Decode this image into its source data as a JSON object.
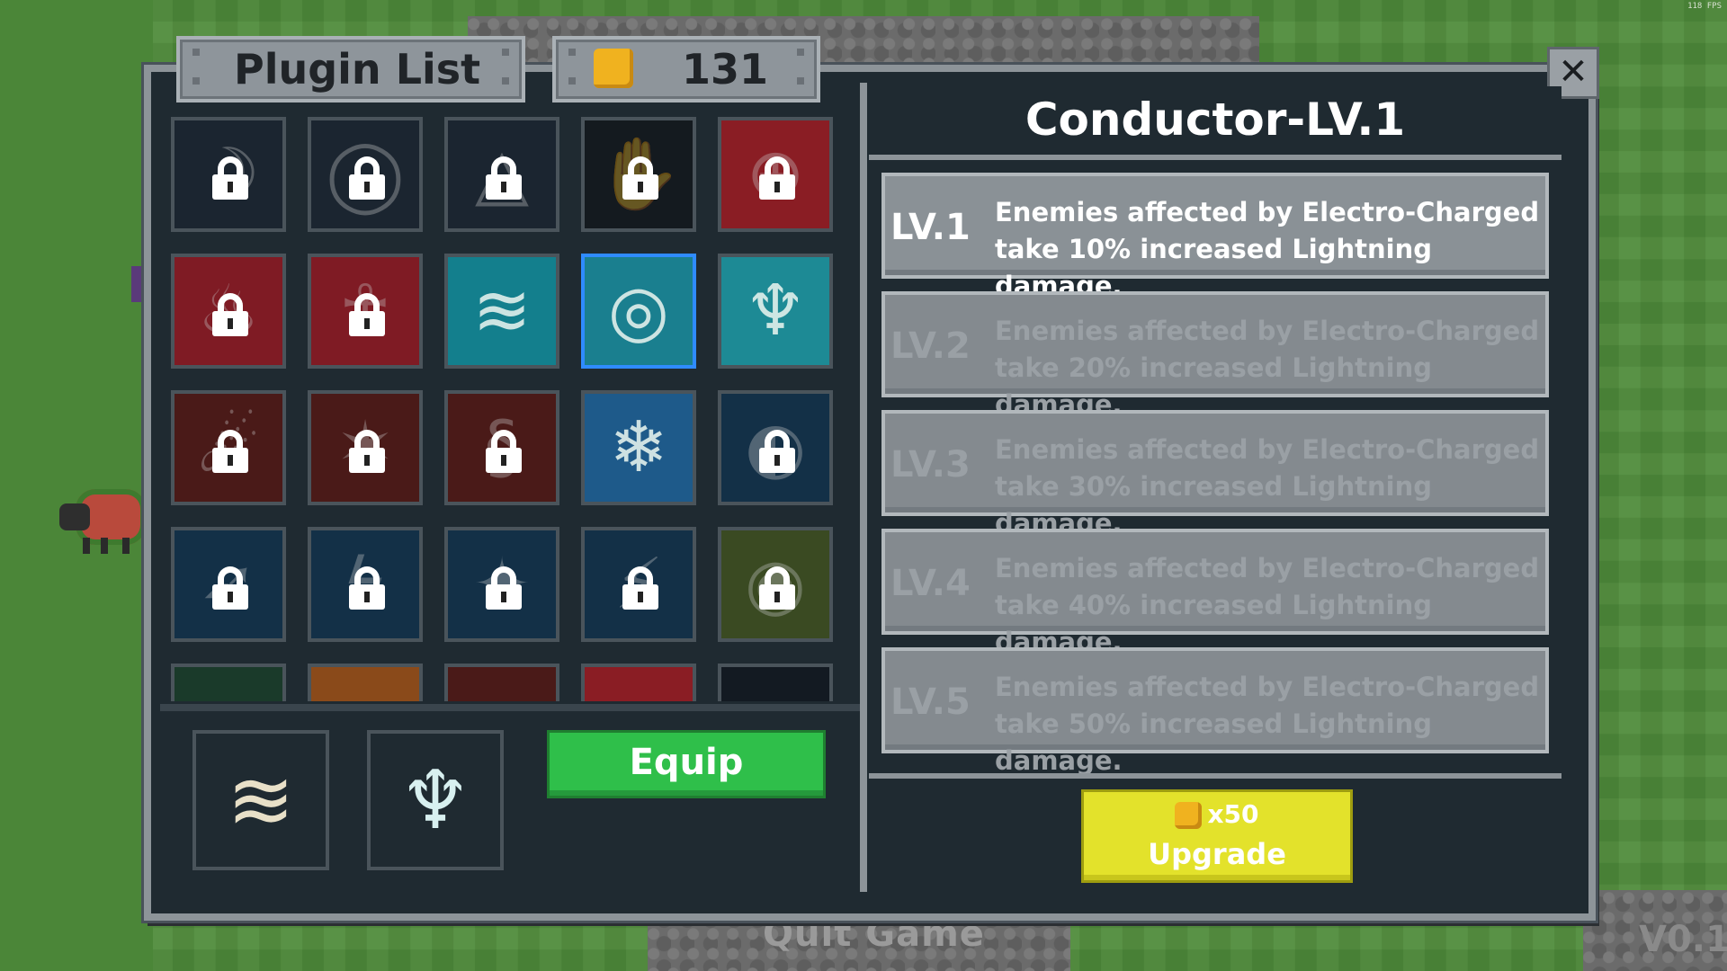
{
  "fps": "118 FPS",
  "footer": {
    "quit": "Quit Game",
    "version": "V0.1"
  },
  "header": {
    "title": "Plugin List",
    "coins": "131"
  },
  "close_label": "✕",
  "grid": [
    {
      "bg": "#1b2530",
      "glyph": "☽",
      "locked": true
    },
    {
      "bg": "#1b2530",
      "glyph": "◯",
      "locked": true
    },
    {
      "bg": "#1b2530",
      "glyph": "△",
      "locked": true
    },
    {
      "bg": "#141a1f",
      "glyph": "✋",
      "locked": true
    },
    {
      "bg": "#8a1d24",
      "glyph": "⊕",
      "locked": true
    },
    {
      "bg": "#7f1b24",
      "glyph": "♨",
      "locked": true
    },
    {
      "bg": "#7f1b24",
      "glyph": "☥",
      "locked": true
    },
    {
      "bg": "#137f8d",
      "glyph": "≋",
      "locked": false
    },
    {
      "bg": "#1a7f8f",
      "glyph": "◎",
      "locked": false,
      "selected": true
    },
    {
      "bg": "#1d8a95",
      "glyph": "♆",
      "locked": false
    },
    {
      "bg": "#4a1a18",
      "glyph": "☄",
      "locked": true
    },
    {
      "bg": "#4a1a18",
      "glyph": "✶",
      "locked": true
    },
    {
      "bg": "#4a1a18",
      "glyph": "§",
      "locked": true
    },
    {
      "bg": "#1e5a8a",
      "glyph": "❄",
      "locked": false
    },
    {
      "bg": "#133047",
      "glyph": "◐",
      "locked": true
    },
    {
      "bg": "#133047",
      "glyph": "➶",
      "locked": true
    },
    {
      "bg": "#133047",
      "glyph": "ϟ",
      "locked": true
    },
    {
      "bg": "#133047",
      "glyph": "✦",
      "locked": true
    },
    {
      "bg": "#133047",
      "glyph": "⚡",
      "locked": true
    },
    {
      "bg": "#3a4a22",
      "glyph": "◉",
      "locked": true
    },
    {
      "bg": "#1a3a2a",
      "glyph": "",
      "locked": false
    },
    {
      "bg": "#8a4a1a",
      "glyph": "",
      "locked": false
    },
    {
      "bg": "#4a1a18",
      "glyph": "",
      "locked": false
    },
    {
      "bg": "#8a1d24",
      "glyph": "",
      "locked": false
    },
    {
      "bg": "#131a22",
      "glyph": "",
      "locked": false
    }
  ],
  "equipped": [
    {
      "bg": "#137f8d",
      "glyph": "≋"
    },
    {
      "bg": "#1d8a95",
      "glyph": "♆"
    }
  ],
  "equip_label": "Equip",
  "detail": {
    "title": "Conductor-LV.1",
    "levels": [
      {
        "tag": "LV.1",
        "desc": "Enemies affected by Electro-Charged take 10% increased Lightning damage.",
        "active": true
      },
      {
        "tag": "LV.2",
        "desc": "Enemies affected by Electro-Charged take 20% increased Lightning damage.",
        "active": false
      },
      {
        "tag": "LV.3",
        "desc": "Enemies affected by Electro-Charged take 30% increased Lightning damage.",
        "active": false
      },
      {
        "tag": "LV.4",
        "desc": "Enemies affected by Electro-Charged take 40% increased Lightning damage.",
        "active": false
      },
      {
        "tag": "LV.5",
        "desc": "Enemies affected by Electro-Charged take 50% increased Lightning damage.",
        "active": false
      }
    ]
  },
  "upgrade": {
    "cost": "x50",
    "label": "Upgrade"
  }
}
